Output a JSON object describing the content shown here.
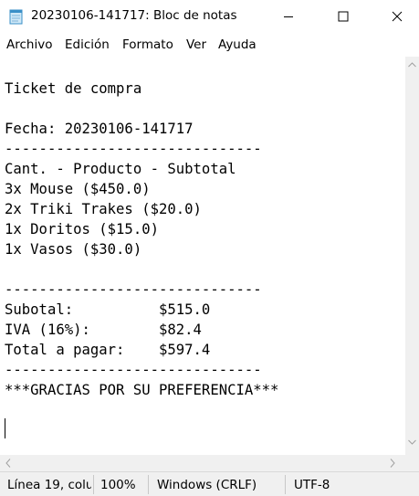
{
  "window": {
    "title": "20230106-141717: Bloc de notas",
    "controls": [
      "minimize",
      "maximize",
      "close"
    ],
    "app_icon": "notepad-icon"
  },
  "menu": {
    "items": [
      "Archivo",
      "Edición",
      "Formato",
      "Ver",
      "Ayuda"
    ]
  },
  "document": {
    "lines": [
      "",
      "Ticket de compra",
      "",
      "Fecha: 20230106-141717",
      "------------------------------",
      "Cant. - Producto - Subtotal",
      "3x Mouse ($450.0)",
      "2x Triki Trakes ($20.0)",
      "1x Doritos ($15.0)",
      "1x Vasos ($30.0)",
      "",
      "------------------------------",
      "Subotal:          $515.0",
      "IVA (16%):        $82.4",
      "Total a pagar:    $597.4",
      "------------------------------",
      "***GRACIAS POR SU PREFERENCIA***",
      "",
      ""
    ]
  },
  "status": {
    "position": "Línea 19, colu",
    "zoom": "100%",
    "line_ending": "Windows (CRLF)",
    "encoding": "UTF-8"
  }
}
